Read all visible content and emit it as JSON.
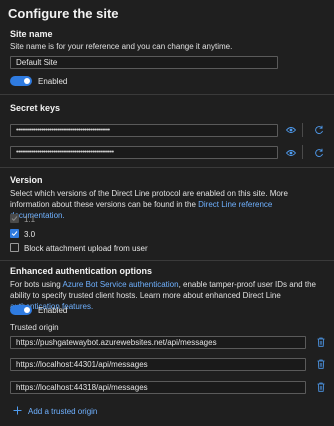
{
  "title": "Configure the site",
  "site_name": {
    "heading": "Site name",
    "description": "Site name is for your reference and you can change it anytime.",
    "value": "Default Site",
    "toggle_label": "Enabled"
  },
  "secret_keys": {
    "heading": "Secret keys",
    "key1": "••••••••••••••••••••••••••••••••••••••••••••••••",
    "key2": "••••••••••••••••••••••••••••••••••••••••••••••••••"
  },
  "version": {
    "heading": "Version",
    "desc_part1": "Select which versions of the Direct Line protocol are enabled on this site. More information about these versions can be found in the ",
    "desc_link": "Direct Line reference documentation.",
    "options": [
      {
        "label": "1.1",
        "checked": true,
        "disabled": true
      },
      {
        "label": "3.0",
        "checked": true,
        "disabled": false
      },
      {
        "label": "Block attachment upload from user",
        "checked": false,
        "disabled": false
      }
    ]
  },
  "enhanced_auth": {
    "heading": "Enhanced authentication options",
    "desc_part1": "For bots using ",
    "desc_link1": "Azure Bot Service authentication",
    "desc_part2": ", enable tamper-proof user IDs and the ability to specify trusted client hosts. Learn more about enhanced Direct Line ",
    "desc_link2": "authentication features.",
    "toggle_label": "Enabled",
    "trusted_origin_label": "Trusted origin",
    "origins": [
      "https://pushgatewaybot.azurewebsites.net/api/messages",
      "https://localhost:44301/api/messages",
      "https://localhost:44318/api/messages"
    ],
    "add_origin_label": "Add a trusted origin"
  },
  "colors": {
    "accent": "#2f7be0",
    "link": "#6fb1ff",
    "background": "#1f1f1f"
  }
}
